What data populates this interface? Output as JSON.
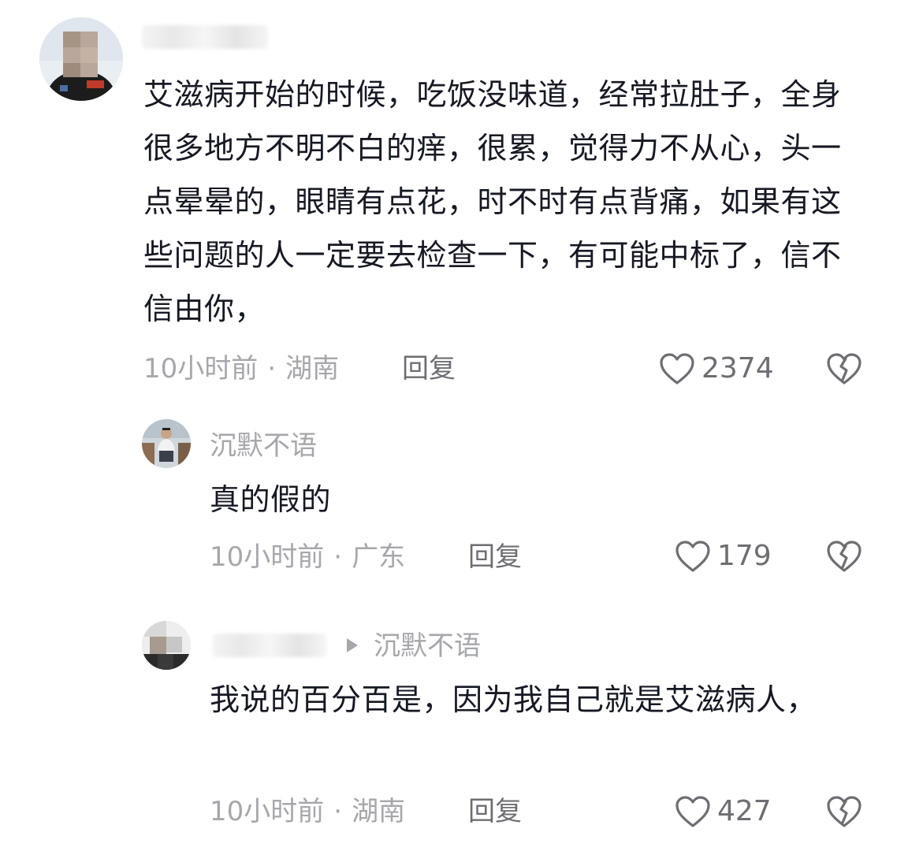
{
  "comments": [
    {
      "username": "",
      "text": "艾滋病开始的时候，吃饭没味道，经常拉肚子，全身很多地方不明不白的痒，很累，觉得力不从心，头一点晕晕的，眼睛有点花，时不时有点背痛，如果有这些问题的人一定要去检查一下，有可能中标了，信不信由你，",
      "time": "10小时前",
      "separator": "·",
      "location": "湖南",
      "reply_label": "回复",
      "likes": "2374"
    },
    {
      "username": "沉默不语",
      "text": "真的假的",
      "time": "10小时前",
      "separator": "·",
      "location": "广东",
      "reply_label": "回复",
      "likes": "179"
    },
    {
      "username": "",
      "reply_to": "沉默不语",
      "text": "我说的百分百是，因为我自己就是艾滋病人，",
      "time": "10小时前",
      "separator": "·",
      "location": "湖南",
      "reply_label": "回复",
      "likes": "427"
    }
  ],
  "icons": {
    "like": "heart-outline-icon",
    "dislike": "broken-heart-icon"
  },
  "colors": {
    "text": "#161823",
    "secondary": "#a6a7ab",
    "action": "#6d6e73"
  }
}
